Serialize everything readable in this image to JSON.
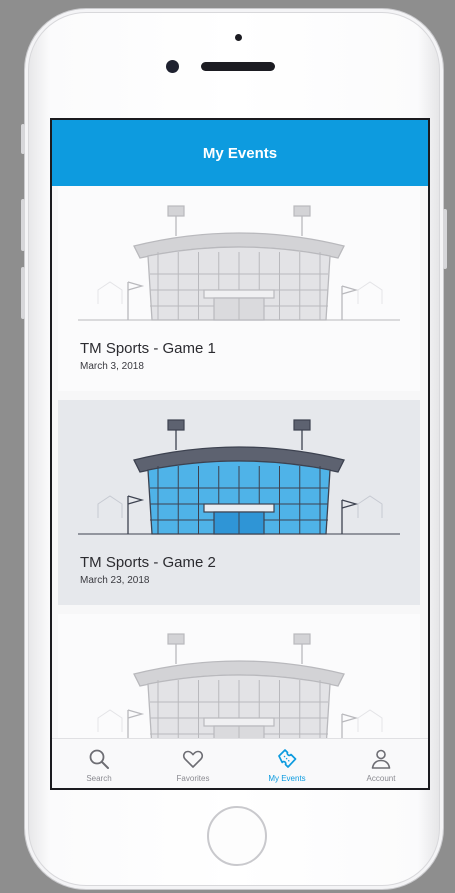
{
  "header": {
    "title": "My Events"
  },
  "events": [
    {
      "title": "TM Sports - Game 1",
      "date": "March 3, 2018",
      "highlighted": false
    },
    {
      "title": "TM Sports - Game 2",
      "date": "March 23, 2018",
      "highlighted": true
    },
    {
      "title": "",
      "date": "",
      "highlighted": false
    }
  ],
  "tabs": [
    {
      "label": "Search",
      "icon": "search-icon",
      "active": false
    },
    {
      "label": "Favorites",
      "icon": "heart-icon",
      "active": false
    },
    {
      "label": "My Events",
      "icon": "ticket-icon",
      "active": true
    },
    {
      "label": "Account",
      "icon": "person-icon",
      "active": false
    }
  ],
  "colors": {
    "accent": "#0d9bdf",
    "stadium_active": "#4fb3e8",
    "stadium_inactive": "#c9c9cc"
  }
}
